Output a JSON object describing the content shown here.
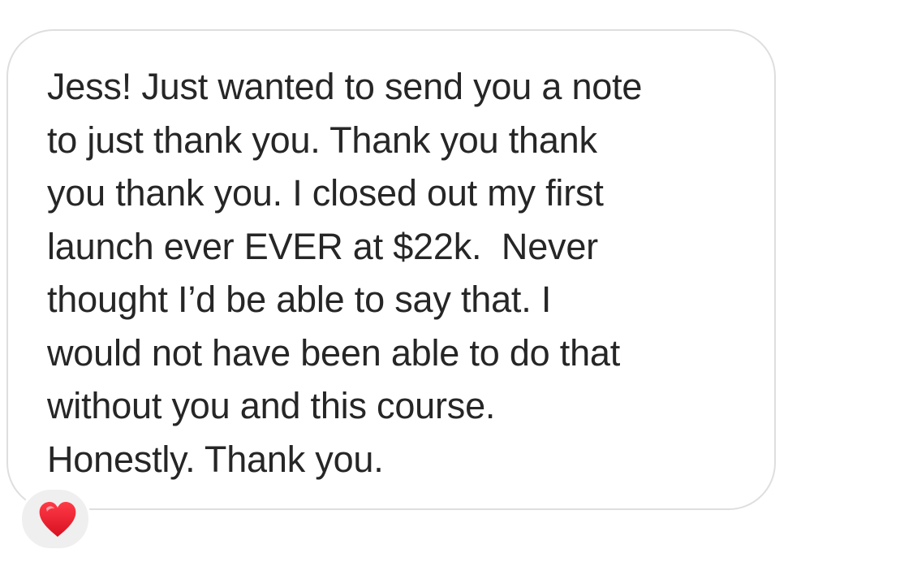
{
  "message": {
    "lines": [
      "Jess! Just wanted to send you a note",
      "to just thank you. Thank you thank",
      "you thank you. I closed out my first",
      "launch ever EVER at $22k.  Never",
      "thought I’d be able to say that. I",
      "would not have been able to do that",
      "without you and this course.",
      "Honestly. Thank you."
    ]
  },
  "reaction": {
    "icon": "heart-icon",
    "color": "#e8192c"
  },
  "colors": {
    "bubble_border": "#dedede",
    "text": "#262626",
    "reaction_background": "#efefef"
  }
}
